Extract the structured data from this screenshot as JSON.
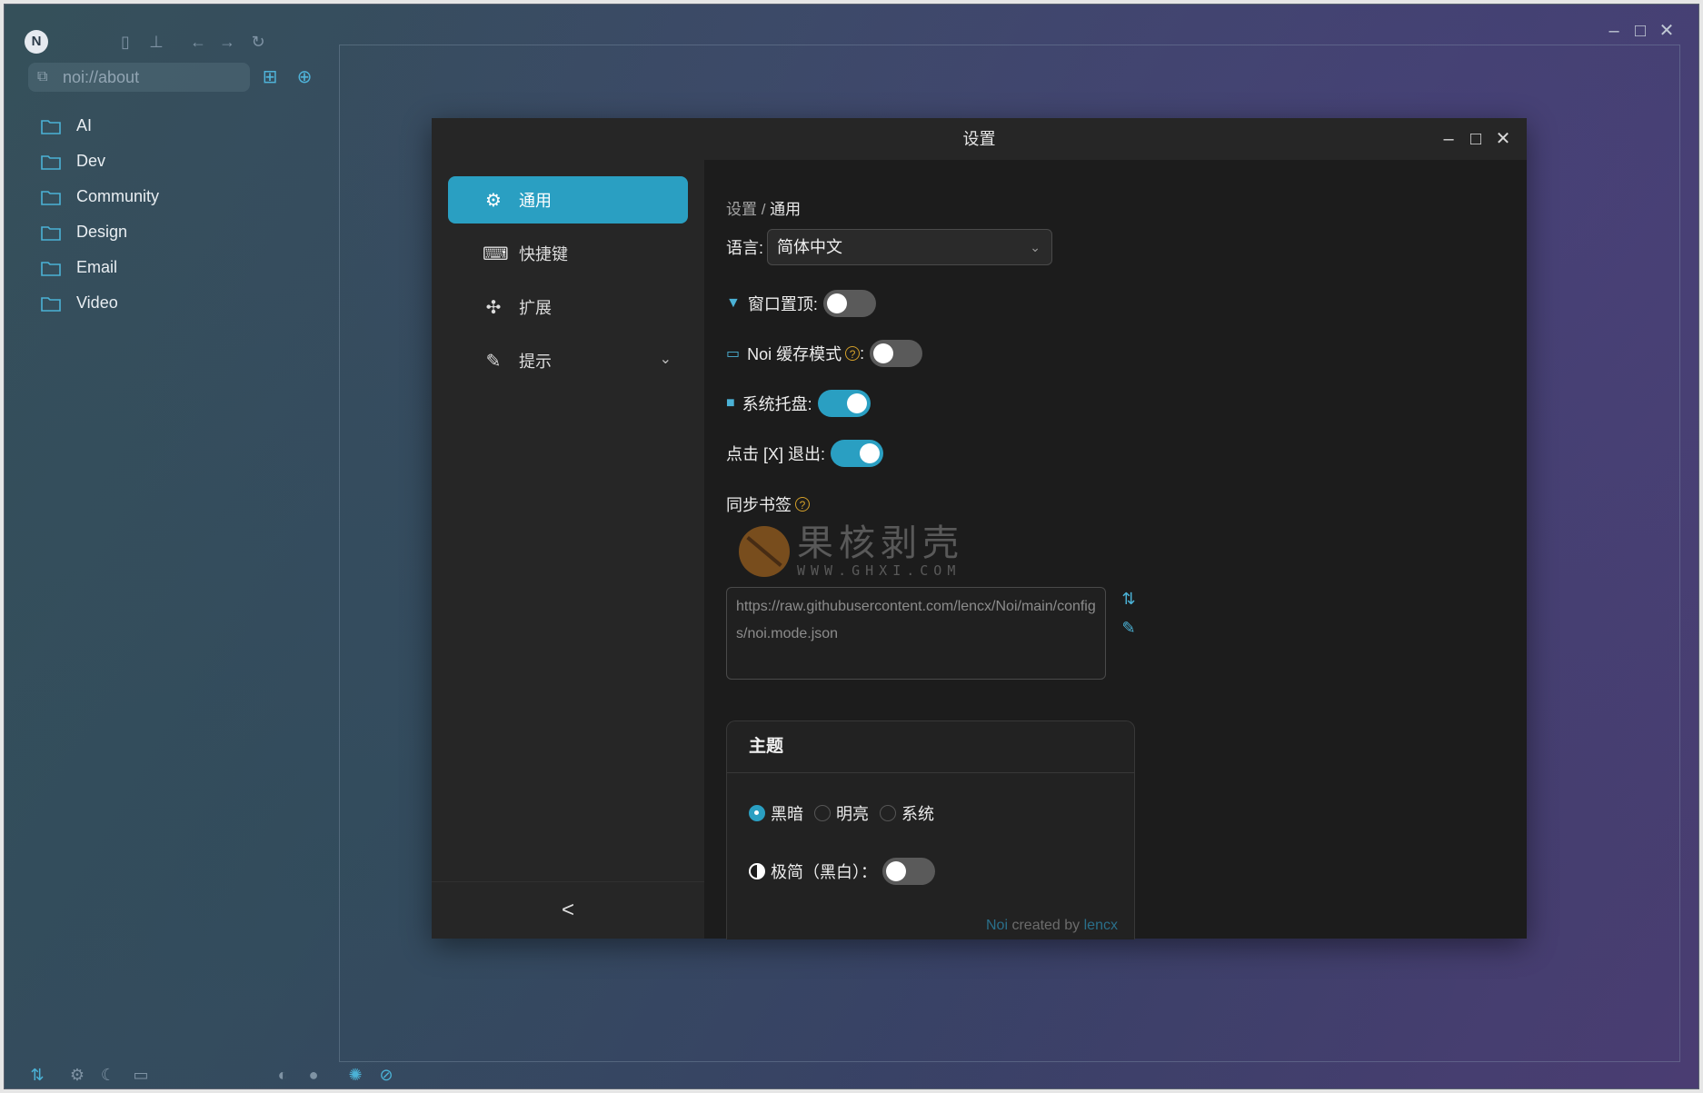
{
  "browser": {
    "url": "noi://about",
    "folders": [
      "AI",
      "Dev",
      "Community",
      "Design",
      "Email",
      "Video"
    ]
  },
  "dialog": {
    "title": "设置",
    "nav": [
      {
        "label": "通用",
        "icon": "gear-icon",
        "active": true
      },
      {
        "label": "快捷键",
        "icon": "keyboard-icon",
        "active": false
      },
      {
        "label": "扩展",
        "icon": "puzzle-icon",
        "active": false
      },
      {
        "label": "提示",
        "icon": "prompt-icon",
        "active": false
      }
    ],
    "collapse_label": "<",
    "breadcrumb": {
      "root": "设置",
      "sep": " / ",
      "current": "通用"
    },
    "language": {
      "label": "语言:",
      "value": "简体中文"
    },
    "always_on_top": {
      "label": "窗口置顶:",
      "on": false
    },
    "cache_mode": {
      "label": "Noi 缓存模式",
      "colon": ":",
      "on": false
    },
    "system_tray": {
      "label": "系统托盘:",
      "on": true
    },
    "click_x_exit": {
      "label": "点击 [X] 退出:",
      "on": true
    },
    "sync_bookmarks": {
      "label": "同步书签",
      "url": "https://raw.githubusercontent.com/lencx/Noi/main/configs/noi.mode.json"
    },
    "theme": {
      "title": "主题",
      "options": [
        "黑暗",
        "明亮",
        "系统"
      ],
      "selected": "黑暗",
      "minimal_label": "极简（黑白）：",
      "minimal_on": false
    },
    "credit": {
      "app": "Noi",
      "middle": " created by ",
      "author": "lencx"
    }
  },
  "watermark": {
    "cn": "果核剥壳",
    "en": "WWW.GHXI.COM"
  },
  "colors": {
    "accent": "#2a9fc2",
    "dialog_bg": "#1c1c1c",
    "nav_bg": "#262626"
  }
}
